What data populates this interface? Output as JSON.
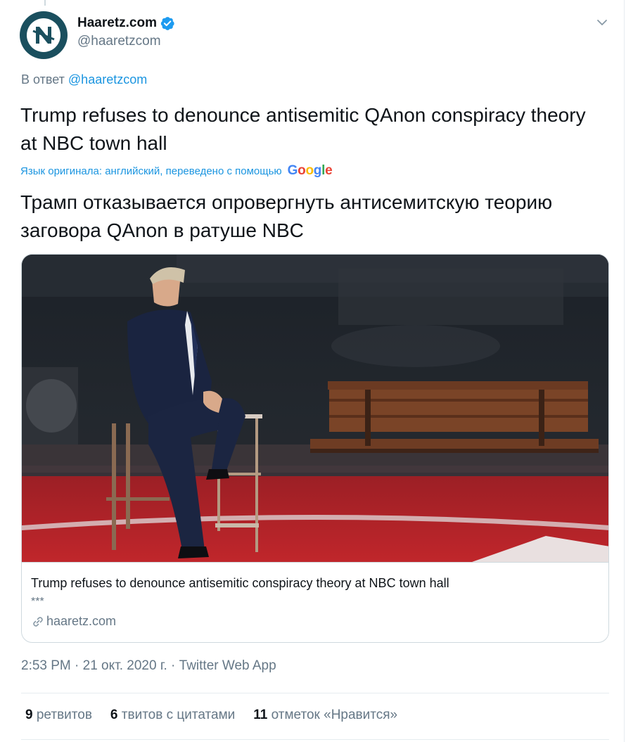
{
  "tweet": {
    "display_name": "Haaretz.com",
    "handle": "@haaretzcom",
    "reply_prefix": "В ответ",
    "reply_to": "@haaretzcom",
    "text": "Trump refuses to denounce antisemitic QAnon conspiracy theory at NBC town hall",
    "translation_note": "Язык оригинала: английский, переведено с помощью",
    "translation_provider": "Google",
    "translated_text": "Трамп отказывается опровергнуть антисемитскую теорию заговора QAnon в ратуше NBC",
    "timestamp": "2:53 PM · 21 окт. 2020 г.",
    "meta_separator": " · ",
    "source_app": "Twitter Web App"
  },
  "card": {
    "title": "Trump refuses to denounce antisemitic conspiracy theory at NBC town hall",
    "description": "***",
    "domain": "haaretz.com"
  },
  "stats": {
    "retweets_count": "9",
    "retweets_label": "ретвитов",
    "quotes_count": "6",
    "quotes_label": "твитов с цитатами",
    "likes_count": "11",
    "likes_label": "отметок «Нравится»"
  },
  "icons": {
    "avatar": "haaretz-logo-icon",
    "verified": "verified-badge-icon",
    "caret": "chevron-down-icon",
    "link": "link-icon"
  },
  "colors": {
    "link_blue": "#1b95e0",
    "verified_blue": "#1d9bf0",
    "secondary_text": "#657786",
    "avatar_bg": "#1a4f5e"
  }
}
